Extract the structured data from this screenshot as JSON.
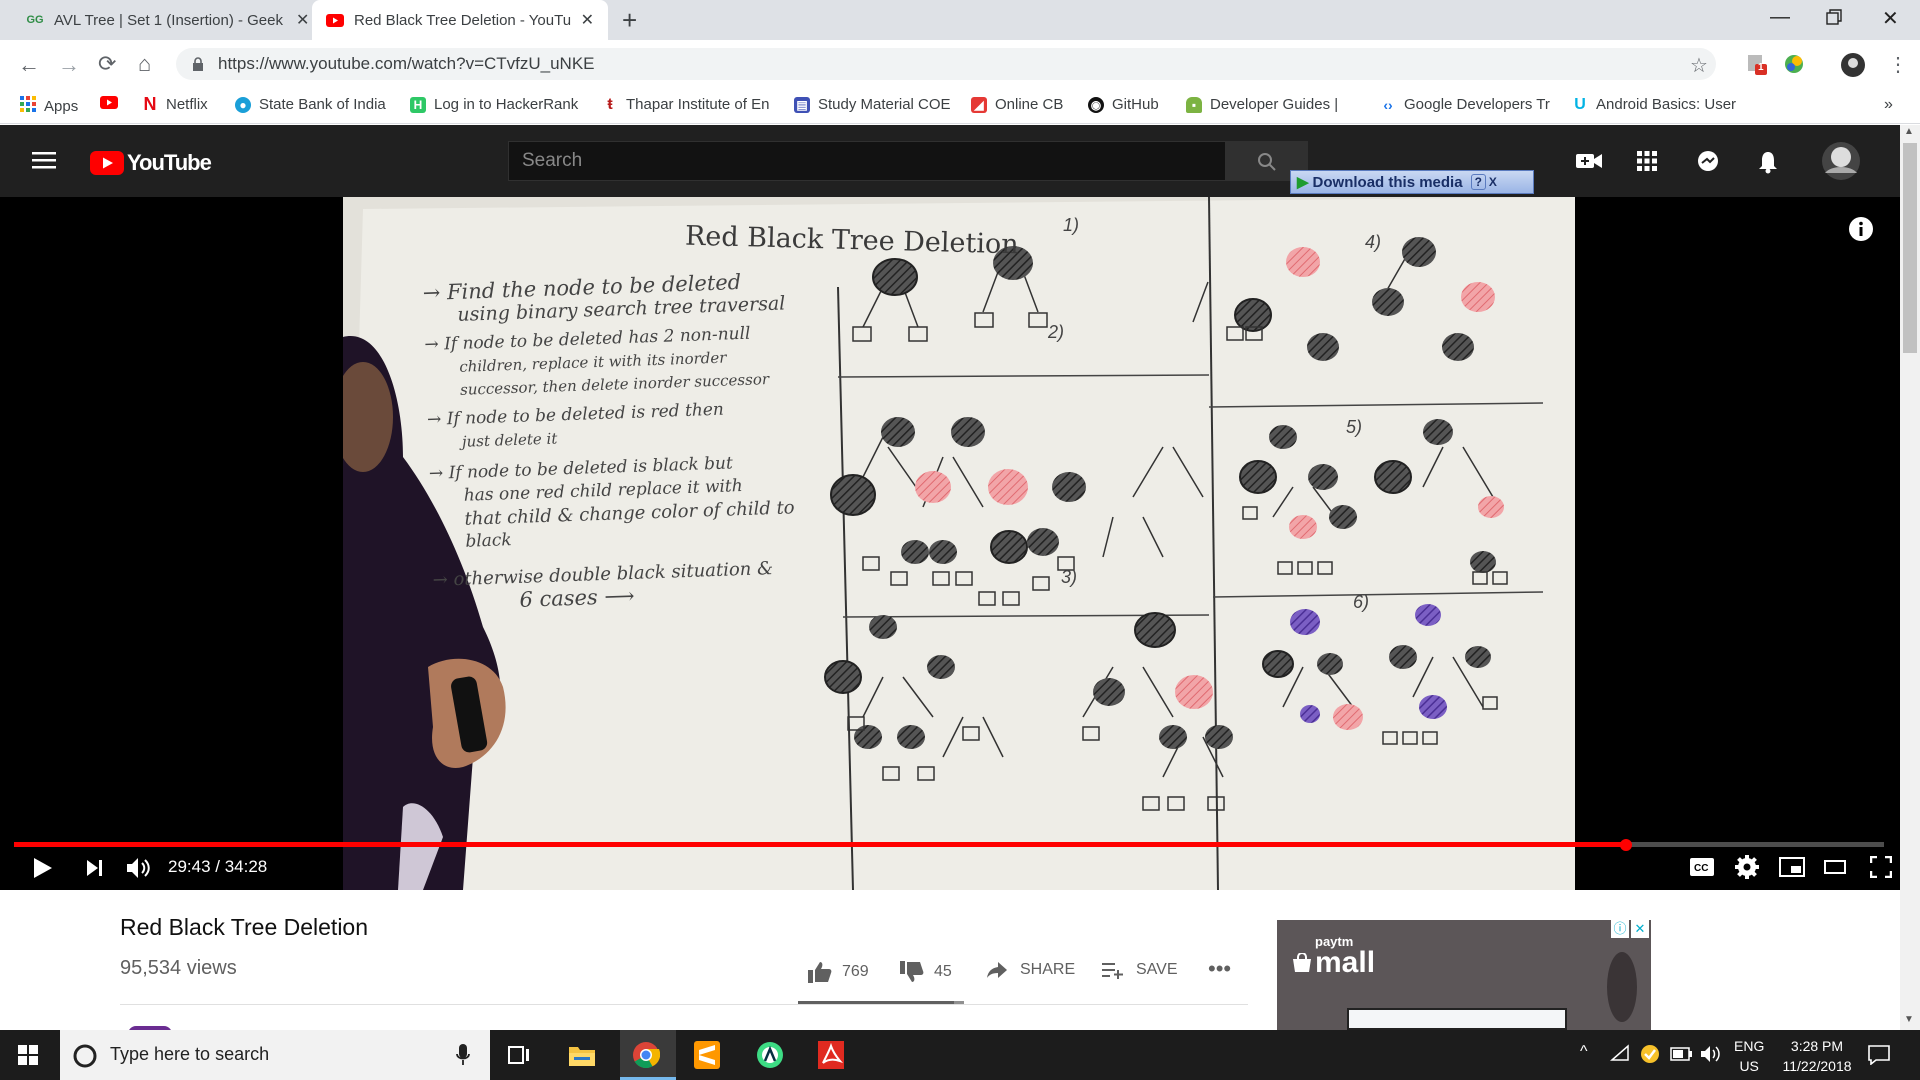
{
  "browser": {
    "tabs": [
      {
        "title": "AVL Tree | Set 1 (Insertion) - Geek",
        "icon": "geeksforgeeks-icon",
        "active": false
      },
      {
        "title": "Red Black Tree Deletion - YouTub",
        "icon": "youtube-icon",
        "active": true
      }
    ],
    "url": "https://www.youtube.com/watch?v=CTvfzU_uNKE",
    "bookmarks": [
      "Apps",
      "Netflix",
      "State Bank of India",
      "Log in to HackerRank",
      "Thapar Institute of En",
      "Study Material COE",
      "Online CB",
      "GitHub",
      "Developer Guides |",
      "Google Developers Tr",
      "Android Basics: User"
    ],
    "extension_badge": "1"
  },
  "youtube": {
    "logo_text": "YouTube",
    "search_placeholder": "Search",
    "download_label": "Download this media",
    "download_help": "?",
    "download_close": "X",
    "video": {
      "time": "29:43 / 34:28",
      "progress": 0.862,
      "whiteboard": {
        "title": "Red Black Tree Deletion",
        "lines": [
          "→ Find the node to be deleted",
          "using binary search tree traversal",
          "→ If node to be deleted has 2 non-null",
          "children, replace it with its inorder",
          "successor, then delete inorder successor",
          "→ If node to be deleted is red then",
          "just delete it",
          "→ If node to be deleted is black but",
          "has one red child replace it with",
          "that child & change color of child to",
          "black",
          "→ otherwise double black situation &",
          "6 cases ⟶"
        ],
        "case_labels": [
          "1)",
          "2)",
          "3)",
          "4)",
          "5)",
          "6)"
        ]
      }
    },
    "title": "Red Black Tree Deletion",
    "views": "95,534 views",
    "likes": "769",
    "dislikes": "45",
    "share_label": "SHARE",
    "save_label": "SAVE",
    "ad_brand": "paytm",
    "ad_text": "mall"
  },
  "taskbar": {
    "search_placeholder": "Type here to search",
    "lang": "ENG",
    "region": "US",
    "time": "3:28 PM",
    "date": "11/22/2018"
  },
  "colors": {
    "youtube_red": "#ff0000",
    "header_bg": "#202020",
    "tab_bg": "#dee1e6"
  }
}
